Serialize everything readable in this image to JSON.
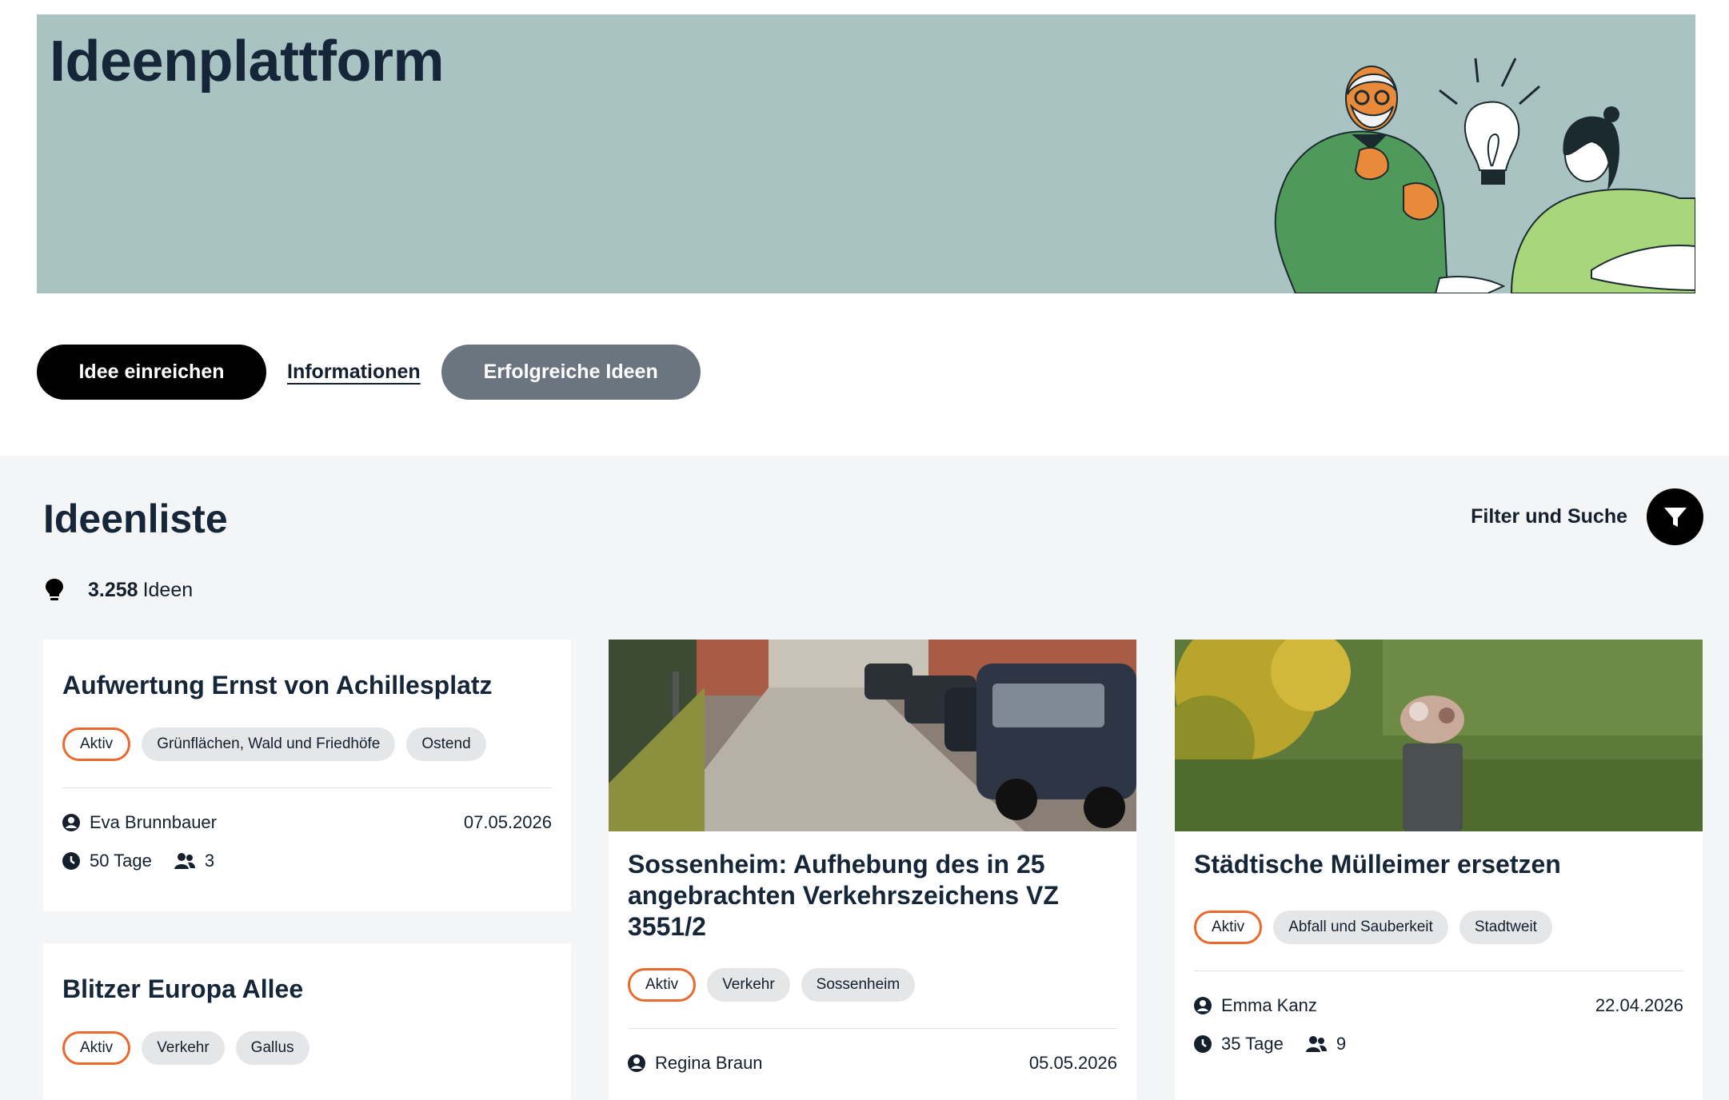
{
  "hero": {
    "title": "Ideenplattform"
  },
  "actions": {
    "submit_label": "Idee einreichen",
    "info_label": "Informationen",
    "successful_label": "Erfolgreiche Ideen"
  },
  "list": {
    "title": "Ideenliste",
    "filter_label": "Filter und Suche",
    "count": "3.258",
    "count_label": "Ideen"
  },
  "cards": [
    {
      "title": "Aufwertung Ernst von Achillesplatz",
      "tags": [
        "Aktiv",
        "Grünflächen, Wald und Friedhöfe",
        "Ostend"
      ],
      "author": "Eva Brunnbauer",
      "date": "07.05.2026",
      "days": "50 Tage",
      "supporters": "3"
    },
    {
      "title": "Blitzer Europa Allee",
      "tags": [
        "Aktiv",
        "Verkehr",
        "Gallus"
      ]
    },
    {
      "title": "Sossenheim: Aufhebung des in 25 angebrachten Verkehrszeichens VZ 3551/2",
      "tags": [
        "Aktiv",
        "Verkehr",
        "Sossenheim"
      ],
      "author": "Regina Braun",
      "date": "05.05.2026"
    },
    {
      "title": "Städtische Mülleimer ersetzen",
      "tags": [
        "Aktiv",
        "Abfall und Sauberkeit",
        "Stadtweit"
      ],
      "author": "Emma Kanz",
      "date": "22.04.2026",
      "days": "35 Tage",
      "supporters": "9"
    }
  ],
  "colors": {
    "hero_bg": "#a9c3c3",
    "status_border": "#ea6a2e",
    "secondary_button": "#6b7580"
  }
}
